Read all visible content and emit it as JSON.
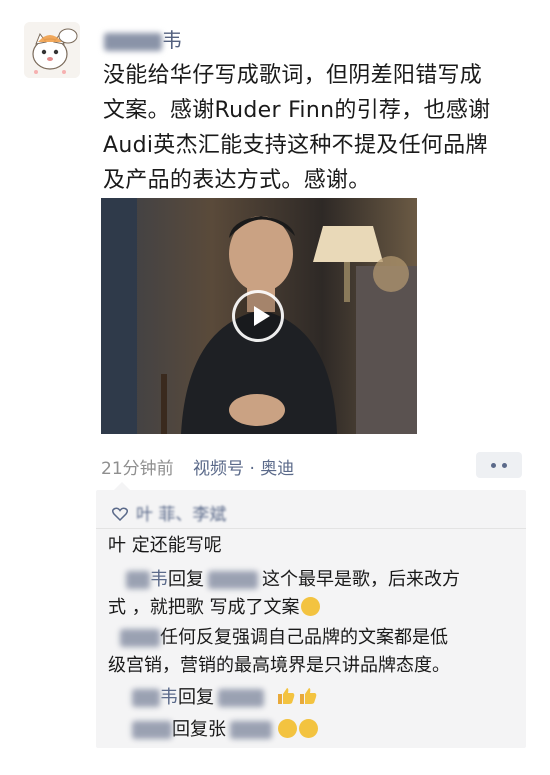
{
  "post": {
    "username": "韦",
    "text_line1": "没能给华仔写成歌词，但阴差阳错写成",
    "text_line2": "文案。感谢Ruder Finn的引荐，也感谢",
    "text_line3": "Audi英杰汇能支持这种不提及任何品牌",
    "text_line4": "及产品的表达方式。感谢。",
    "time": "21分钟前",
    "source": "视频号 · 奥迪"
  },
  "comments": {
    "likes": "叶 菲、李斌",
    "c1": "叶      定还能写呢",
    "c2_name": "韦",
    "c2_reply": "回复",
    "c2_text": "这个最早是歌，后来改方",
    "c2_text2": "式 ，就把歌   写成了文案",
    "c3_text": "任何反复强调自己品牌的文案都是低",
    "c3_text2": "级宫销，营销的最高境界是只讲品牌态度。",
    "c4_name": "韦",
    "c4_reply": "回复",
    "c5_reply": "回复张"
  },
  "colors": {
    "link": "#5b6a8a",
    "meta": "#8f8f8f",
    "comment_bg": "#f4f4f5"
  }
}
